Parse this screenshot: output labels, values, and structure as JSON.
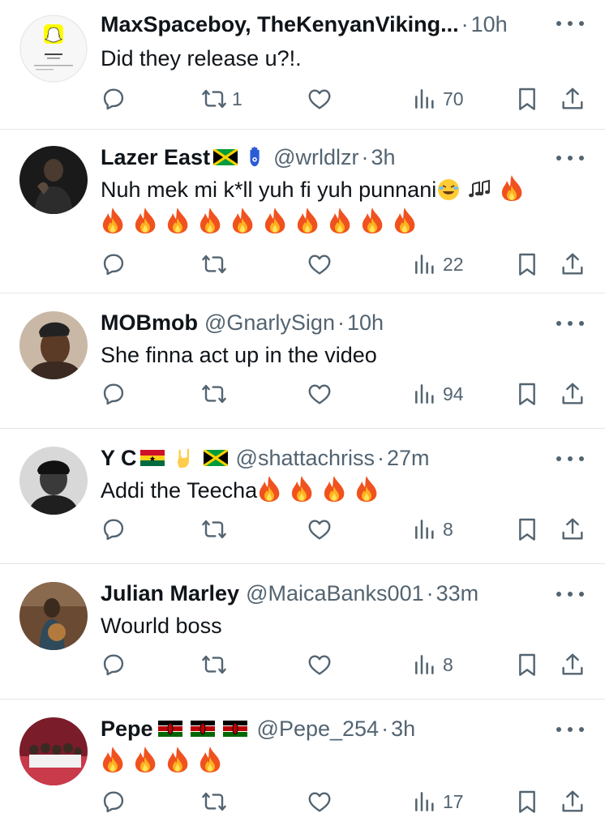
{
  "tweets": [
    {
      "name": "MaxSpaceboy, TheKenyanViking...",
      "handle": "",
      "dot": "·",
      "time": "10h",
      "text": "Did they release u?!.",
      "stats": {
        "reply": "",
        "retweet": "1",
        "like": "",
        "views": "70"
      }
    },
    {
      "name": "Lazer East",
      "handle": "@wrldlzr",
      "dot": "·",
      "time": "3h",
      "text": "Nuh mek mi k*ll yuh fi yuh punnani",
      "stats": {
        "reply": "",
        "retweet": "",
        "like": "",
        "views": "22"
      }
    },
    {
      "name": "MOBmob",
      "handle": "@GnarlySign",
      "dot": "·",
      "time": "10h",
      "text": "She finna act up in the video",
      "stats": {
        "reply": "",
        "retweet": "",
        "like": "",
        "views": "94"
      }
    },
    {
      "name": "Y C",
      "handle": "@shattachriss",
      "dot": "·",
      "time": "27m",
      "text": "Addi the Teecha",
      "stats": {
        "reply": "",
        "retweet": "",
        "like": "",
        "views": "8"
      }
    },
    {
      "name": "Julian Marley",
      "handle": "@MaicaBanks001",
      "dot": "·",
      "time": "33m",
      "text": "Wourld boss",
      "stats": {
        "reply": "",
        "retweet": "",
        "like": "",
        "views": "8"
      }
    },
    {
      "name": "Pepe",
      "handle": "@Pepe_254",
      "dot": "·",
      "time": "3h",
      "text": "",
      "stats": {
        "reply": "",
        "retweet": "",
        "like": "",
        "views": "17"
      }
    }
  ],
  "icons": [
    "reply-icon",
    "retweet-icon",
    "like-icon",
    "views-icon",
    "bookmark-icon",
    "share-icon",
    "more-icon",
    "fire-emoji"
  ],
  "colors": {
    "text": "#0f1419",
    "secondary": "#536471",
    "divider": "#e3e6e9",
    "background": "#ffffff"
  }
}
